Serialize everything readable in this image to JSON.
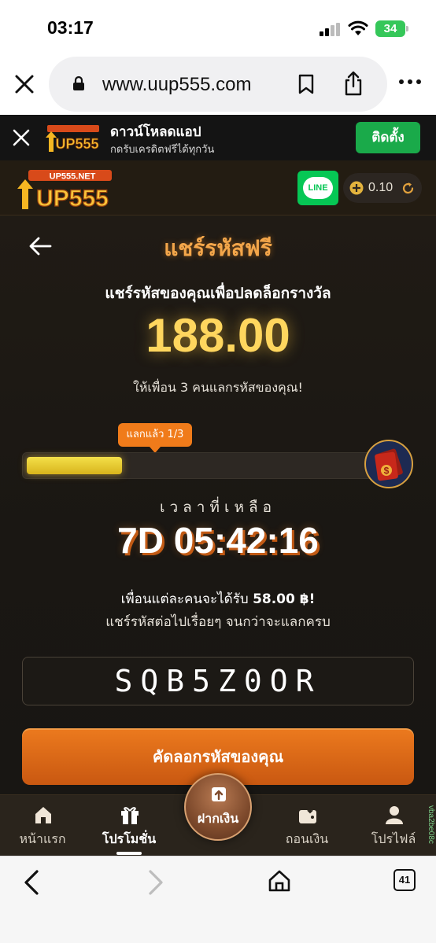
{
  "status_bar": {
    "time": "03:17",
    "battery": "34"
  },
  "browser": {
    "url": "www.uup555.com",
    "tab_count": "41"
  },
  "app_banner": {
    "title": "ดาวน์โหลดแอป",
    "subtitle": "กดรับเครดิตฟรีได้ทุกวัน",
    "install_label": "ติดตั้ง",
    "logo_text": "UP555"
  },
  "header": {
    "logo_text": "UP555",
    "logo_subtext": "UP555.NET",
    "line_label": "LINE",
    "balance": "0.10"
  },
  "page": {
    "title": "แชร์รหัสฟรี",
    "subtitle": "แชร์รหัสของคุณเพื่อปลดล็อกรางวัล",
    "reward_amount": "188.00",
    "invite_text": "ให้เพื่อน 3 คนแลกรหัสของคุณ!",
    "progress_label": "แลกแล้ว 1/3",
    "progress": {
      "redeemed": 1,
      "required": 3
    },
    "time_label": "เวลาที่เหลือ",
    "countdown": "7D 05:42:16",
    "info_prefix": "เพื่อนแต่ละคนจะได้รับ",
    "info_amount": "58.00 ฿!",
    "info_line_2": "แชร์รหัสต่อไปเรื่อยๆ จนกว่าจะแลกครบ",
    "share_code": "SQB5Z0OR",
    "copy_button": "คัดลอกรหัสของคุณ"
  },
  "tabs": [
    {
      "label": "หน้าแรก",
      "icon": "home-icon"
    },
    {
      "label": "โปรโมชั่น",
      "icon": "gift-icon",
      "active": true
    },
    {
      "label": "ฝากเงิน",
      "icon": "deposit-icon"
    },
    {
      "label": "ถอนเงิน",
      "icon": "wallet-icon"
    },
    {
      "label": "โปรไฟล์",
      "icon": "profile-icon"
    }
  ],
  "side_code": "vba2be08c",
  "colors": {
    "accent": "#f07b1a",
    "gold": "#ffd65e",
    "background": "#1a1713",
    "line_green": "#06c755",
    "install_green": "#1aaa4a"
  }
}
